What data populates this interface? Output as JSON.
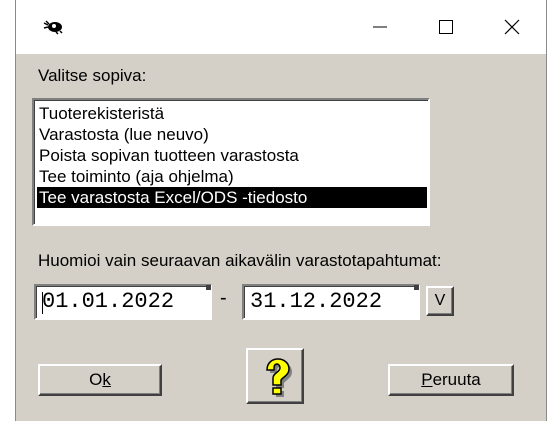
{
  "titlebar": {
    "app_icon": "bug-eye-icon",
    "minimize_icon": "minimize-icon",
    "maximize_icon": "maximize-icon",
    "close_icon": "close-icon"
  },
  "dialog": {
    "choose_label": "Valitse sopiva:",
    "list_items": [
      "Tuoterekisteristä",
      "Varastosta (lue neuvo)",
      "Poista sopivan tuotteen varastosta",
      "Tee toiminto (aja ohjelma)",
      "Tee varastosta Excel/ODS -tiedosto"
    ],
    "selected_index": 4,
    "period_label": "Huomioi vain seuraavan aikavälin varastotapahtumat:",
    "start_date": "01.01.2022",
    "separator": "-",
    "end_date": "31.12.2022",
    "v_button": "V",
    "ok_prefix": "O",
    "ok_accel": "k",
    "help_icon": "question-mark-icon",
    "cancel_accel": "P",
    "cancel_rest": "eruuta"
  },
  "colors": {
    "dialog_bg": "#d4d0c8",
    "selection_bg": "#000000",
    "selection_fg": "#ffffff",
    "help_icon_fill": "#ffff00"
  }
}
